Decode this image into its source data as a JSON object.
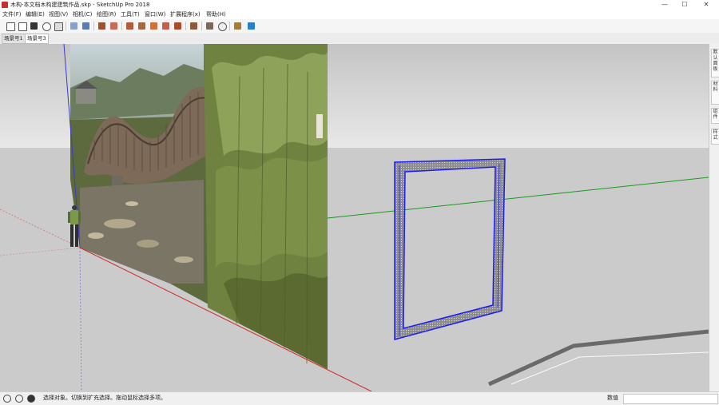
{
  "window": {
    "title": "木构-本文档木构建建筑作品.skp - SketchUp Pro 2018",
    "minimize": "—",
    "maximize": "☐",
    "close": "✕"
  },
  "menu": [
    "文件(F)",
    "编辑(E)",
    "视图(V)",
    "相机(C)",
    "绘图(R)",
    "工具(T)",
    "窗口(W)",
    "扩展程序(x)",
    "帮助(H)"
  ],
  "tabs": [
    "场景号1",
    "场景号3"
  ],
  "side_panel": [
    "默认面板",
    "材料",
    "组件",
    "样式"
  ],
  "status": {
    "message": "选择对象。切换到扩充选择。拖动鼠标选择多项。",
    "measurements_label": "数值"
  },
  "colors": {
    "sky": "#d4d4d4",
    "ground": "#c9c9c9",
    "selection_blue": "#1a1aff",
    "frame_fill": "#8c8c8c",
    "red_axis": "#cc2a2a",
    "green_axis": "#1c9a1c",
    "blue_axis": "#3a3ad0"
  },
  "icons": [
    "new-icon",
    "open-icon",
    "save-icon",
    "undo-icon",
    "print-icon",
    "model-info-icon",
    "components-icon",
    "paint-icon",
    "eraser-icon",
    "tape-icon",
    "line-icon",
    "arc-icon",
    "pencil-icon",
    "push-pull-icon",
    "move-icon",
    "rotate-icon",
    "orbit-icon",
    "walk-icon",
    "section-icon"
  ]
}
